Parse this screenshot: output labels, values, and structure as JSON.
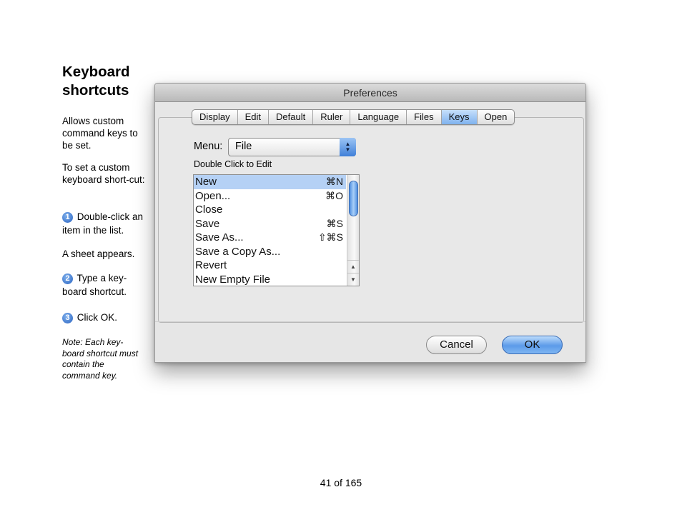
{
  "side": {
    "title": "Keyboard shortcuts",
    "intro": "Allows custom command keys to be set.",
    "set_custom": "To set a custom keyboard short-cut:",
    "step1_num": "1",
    "step1": "Double-click an item in the list.",
    "sheet": "A sheet appears.",
    "step2_num": "2",
    "step2": "Type a key-board shortcut.",
    "step3_num": "3",
    "step3": "Click OK.",
    "note": "Note: Each key-board shortcut must contain the command key."
  },
  "window": {
    "title": "Preferences",
    "tabs": [
      "Display",
      "Edit",
      "Default",
      "Ruler",
      "Language",
      "Files",
      "Keys",
      "Open"
    ],
    "selected_tab": "Keys",
    "menu_label": "Menu:",
    "menu_value": "File",
    "popup_icon": "updown-arrows-icon",
    "double_click_hint": "Double Click to Edit",
    "items": [
      {
        "label": "New",
        "shortcut": "⌘N"
      },
      {
        "label": "Open...",
        "shortcut": "⌘O"
      },
      {
        "label": "Close",
        "shortcut": ""
      },
      {
        "label": "Save",
        "shortcut": "⌘S"
      },
      {
        "label": "Save As...",
        "shortcut": "⇧⌘S"
      },
      {
        "label": "Save a Copy As...",
        "shortcut": ""
      },
      {
        "label": "Revert",
        "shortcut": ""
      },
      {
        "label": "New Empty File",
        "shortcut": ""
      }
    ],
    "selected_item": "New",
    "cancel_label": "Cancel",
    "ok_label": "OK"
  },
  "colors": {
    "selection": "#b5d1f5",
    "tab_selected": "#7fb2ee",
    "accent": "#3f7fd8"
  },
  "footer": {
    "page": "41 of 165"
  }
}
